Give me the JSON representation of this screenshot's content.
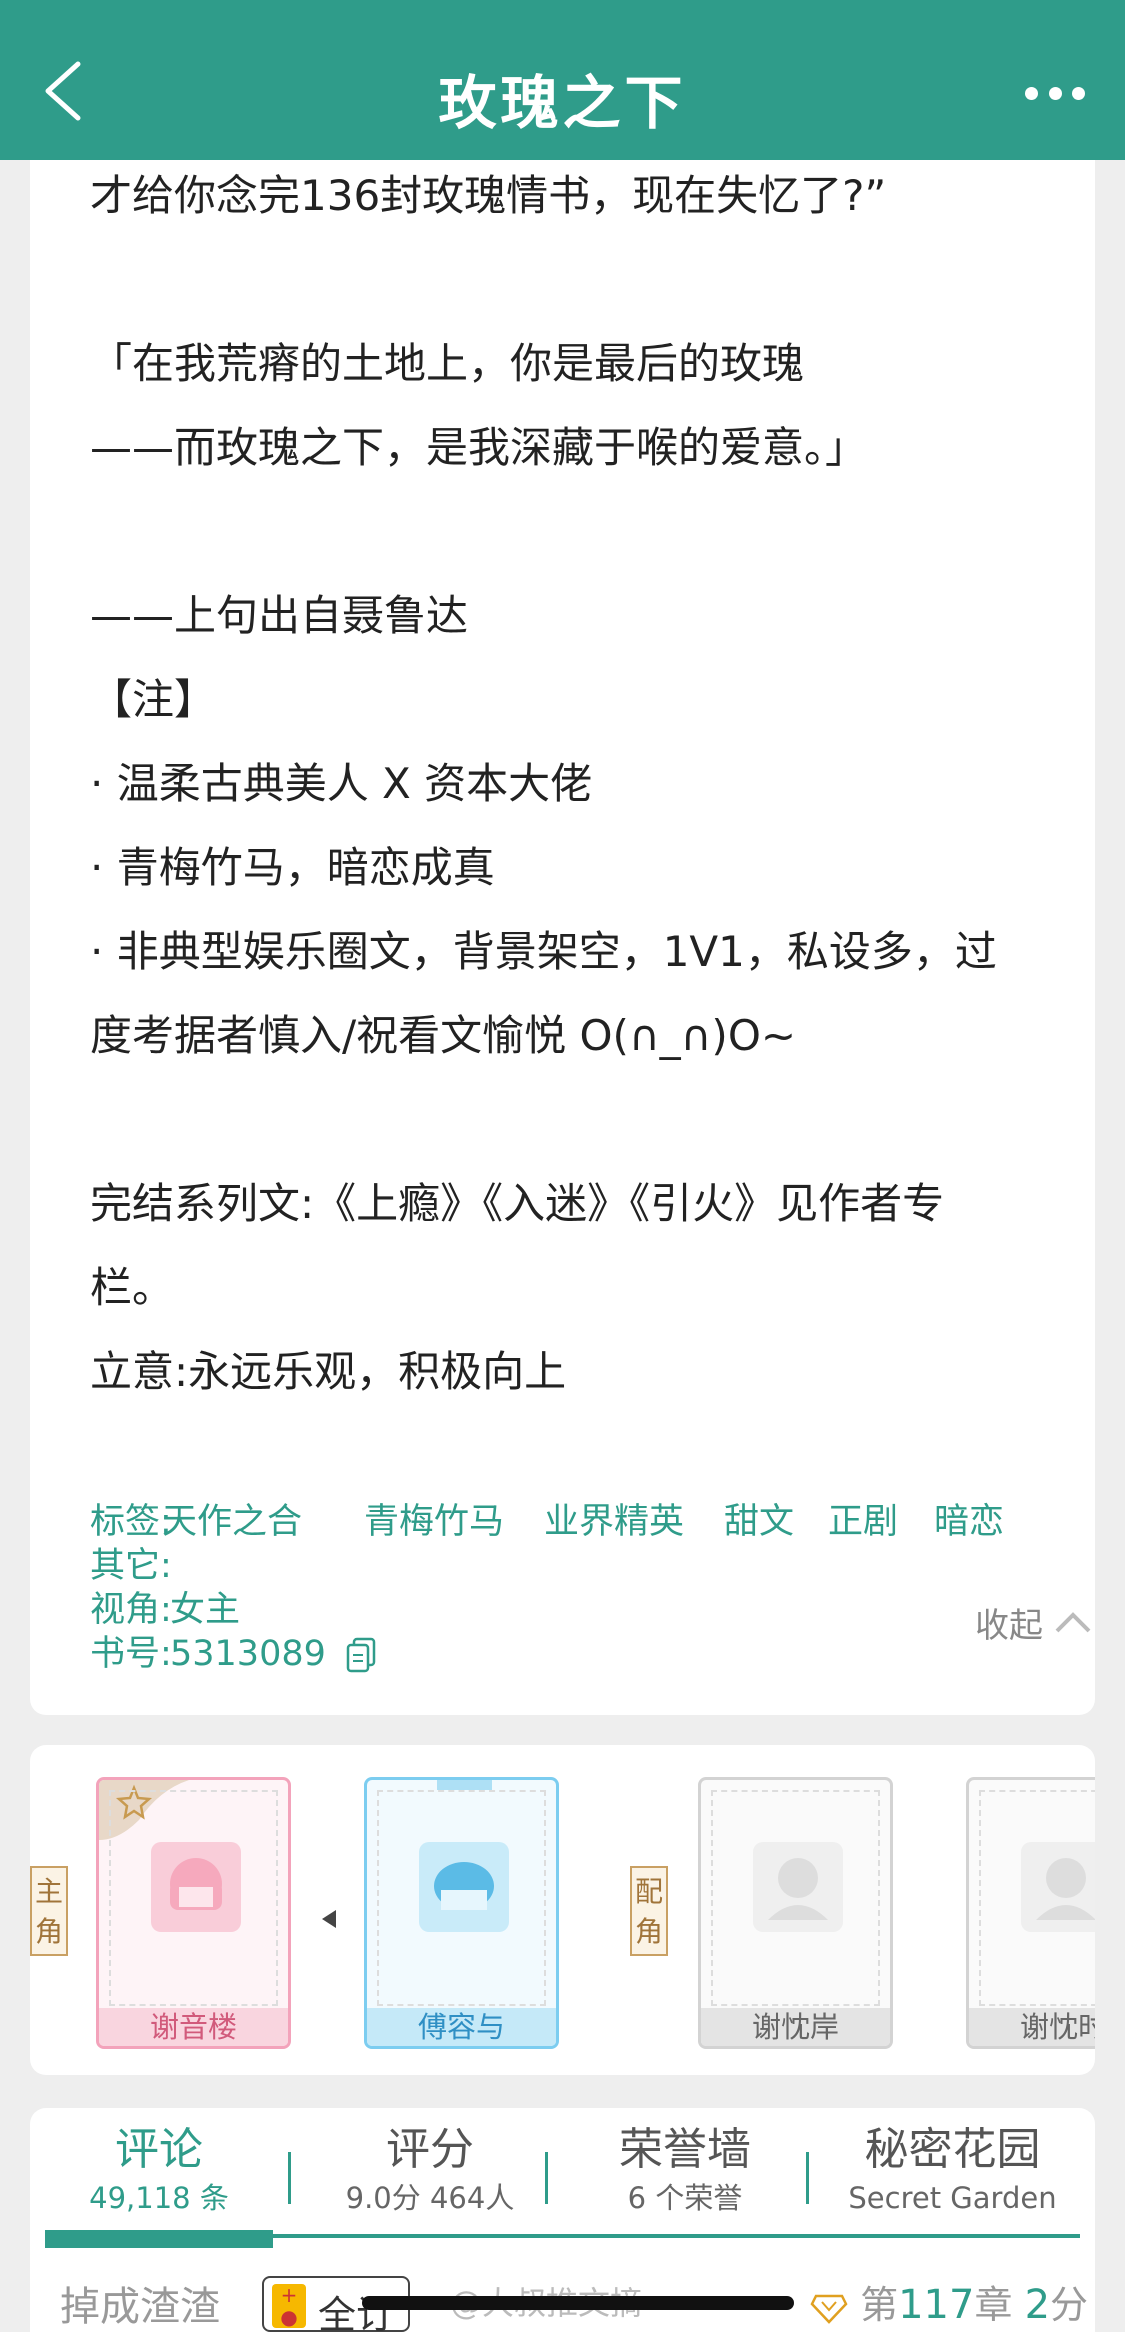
{
  "nav": {
    "title": "玫瑰之下"
  },
  "description": [
    "才给你念完136封玫瑰情书，现在失忆了?”",
    "「在我荒瘠的土地上，你是最后的玫瑰",
    "——而玫瑰之下，是我深藏于喉的爱意。」",
    "——上句出自聂鲁达",
    "【注】",
    "· 温柔古典美人 X 资本大佬",
    "· 青梅竹马，暗恋成真",
    "· 非典型娱乐圈文，背景架空，1V1，私设多，过",
    "度考据者慎入/祝看文愉悦 O(∩_∩)O~",
    "完结系列文:《上瘾》《入迷》《引火》见作者专",
    "栏。",
    "立意:永远乐观，积极向上"
  ],
  "collapse_label": "收起",
  "meta": {
    "tags_label": "标签:",
    "tags": [
      "天作之合",
      "青梅竹马",
      "业界精英",
      "甜文",
      "正剧",
      "暗恋"
    ],
    "other_label": "其它:",
    "pov_label": "视角:",
    "pov_value": "女主",
    "book_id_label": "书号:",
    "book_id": "5313089"
  },
  "roles": {
    "main_label": "主角",
    "supporting_label": "配角",
    "main": [
      "谢音楼",
      "傅容与"
    ],
    "supporting": [
      "谢忱岸",
      "谢忱时"
    ]
  },
  "tabs": [
    {
      "label": "评论",
      "sub": "49,118 条"
    },
    {
      "label": "评分",
      "sub": "9.0分 464人"
    },
    {
      "label": "荣誉墙",
      "sub": "6 个荣誉"
    },
    {
      "label": "秘密花园",
      "sub": "Secret Garden"
    }
  ],
  "bottom": {
    "reviewer": "掉成渣渣",
    "badge": "全订",
    "watermark": "@大叔推文摘",
    "chapter_prefix": "第",
    "chapter_num": "117",
    "chapter_mid": "章",
    "score": "2",
    "score_unit": "分"
  },
  "colors": {
    "accent": "#2f9c8a",
    "main_card": "#f3a3bb",
    "male_card": "#6cc4e8",
    "supporting_card": "#cccccc"
  }
}
